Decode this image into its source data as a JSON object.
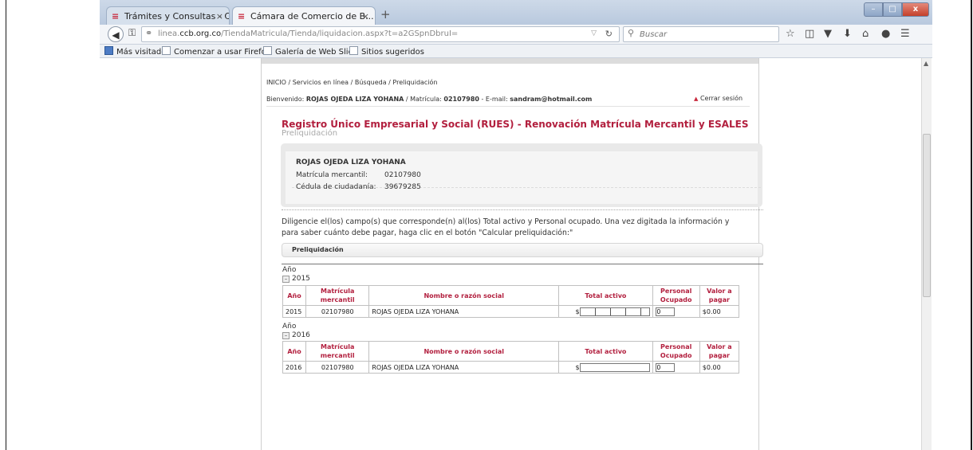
{
  "browser": {
    "tabs": [
      {
        "label": "Trámites y Consultas - Cá...",
        "close": "×",
        "favicon": "ccb-favicon"
      },
      {
        "label": "Cámara de Comercio de B...",
        "close": "×",
        "favicon": "ccb-favicon"
      }
    ],
    "new_tab": "+",
    "window_buttons": {
      "minimize": "–",
      "maximize": "□",
      "close": "x"
    },
    "url": {
      "host": "linea.ccb.org.co",
      "prefix": "linea.",
      "domain": "ccb.org.co",
      "path": "/TiendaMatricula/Tienda/liquidacion.aspx?t=a2GSpnDbruI="
    },
    "search_placeholder": "Buscar",
    "bookmarks": [
      "Más visitados",
      "Comenzar a usar Firefox",
      "Galería de Web Slice",
      "Sitios sugeridos"
    ]
  },
  "page": {
    "breadcrumb": "INICIO / Servicios en línea / Búsqueda / Preliquidación",
    "welcome": {
      "prefix": "Bienvenido: ",
      "name": "ROJAS OJEDA LIZA YOHANA",
      "matricula_label": " / Matrícula: ",
      "matricula": "02107980",
      "email_label": " - E-mail: ",
      "email": "sandram@hotmail.com"
    },
    "logout": "Cerrar sesión",
    "title": "Registro Único Empresarial y Social (RUES) - Renovación Matrícula Mercantil y ESALES",
    "subtitle": "Preliquidación",
    "info": {
      "name": "ROJAS OJEDA LIZA YOHANA",
      "matricula_label": "Matrícula mercantil:",
      "matricula_value": "02107980",
      "cedula_label": "Cédula de ciudadanía:",
      "cedula_value": "39679285"
    },
    "instructions": "Diligencie el(los) campo(s) que corresponde(n) al(los) Total activo y Personal ocupado. Una vez digitada la información y para saber cuánto debe pagar, haga clic en el botón \"Calcular preliquidación:\"",
    "section_tab": "Preliquidación",
    "table_headers": {
      "anio": "Año",
      "matricula": "Matrícula mercantil",
      "nombre": "Nombre o razón social",
      "total": "Total activo",
      "personal": "Personal Ocupado",
      "valor": "Valor a pagar"
    },
    "groups": [
      {
        "group_label": "Año",
        "year": "2015",
        "toggle": "–",
        "row": {
          "anio": "2015",
          "matricula": "02107980",
          "nombre": "ROJAS OJEDA LIZA YOHANA",
          "currency": "$",
          "total_activo": "",
          "personal": "0",
          "valor": "$0.00"
        }
      },
      {
        "group_label": "Año",
        "year": "2016",
        "toggle": "–",
        "row": {
          "anio": "2016",
          "matricula": "02107980",
          "nombre": "ROJAS OJEDA LIZA YOHANA",
          "currency": "$",
          "total_activo": "",
          "personal": "0",
          "valor": "$0.00"
        }
      }
    ]
  }
}
